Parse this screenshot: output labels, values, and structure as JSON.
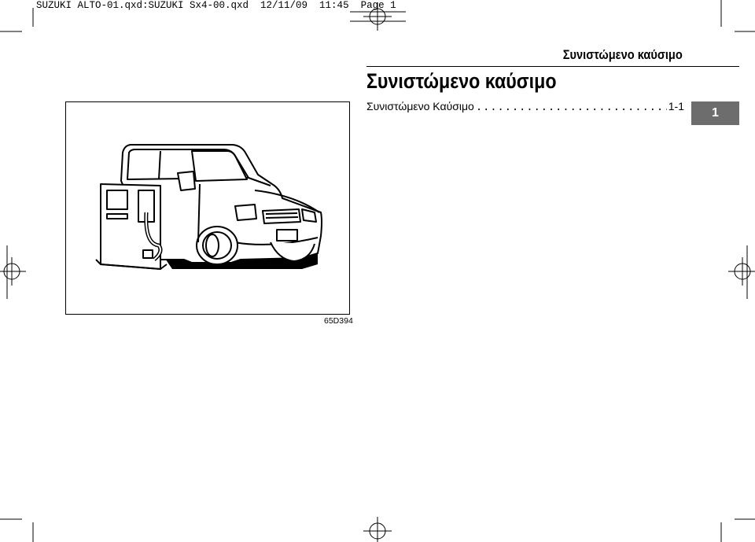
{
  "slug_line": "SUZUKI ALTO-01.qxd:SUZUKI Sx4-00.qxd  12/11/09  11:45  Page 1",
  "header": {
    "title": "Συνιστώμενο καύσιμο"
  },
  "section": {
    "title": "Συνιστώμενο καύσιμο"
  },
  "toc": {
    "label": "Συνιστώμενο Καύσιμο",
    "leader": "................................................",
    "page_ref": "1-1"
  },
  "chapter_tab": {
    "number": "1"
  },
  "figure": {
    "code": "65D394",
    "icons": [
      "car-icon",
      "fuel-pump-icon"
    ]
  },
  "colors": {
    "tab_bg": "#6d6d6d",
    "ink": "#000000",
    "paper": "#ffffff"
  }
}
